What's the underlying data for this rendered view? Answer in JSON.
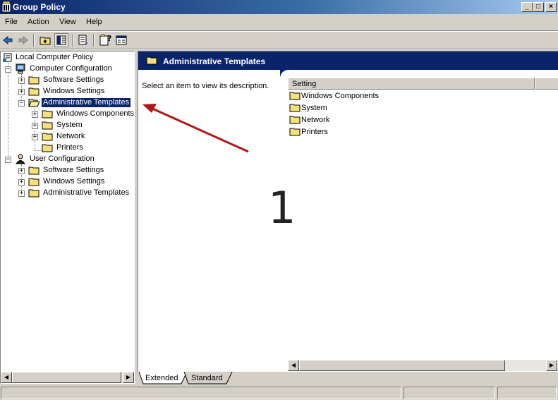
{
  "window": {
    "title": "Group Policy",
    "minimize_glyph": "_",
    "maximize_glyph": "□",
    "close_glyph": "×"
  },
  "menu": {
    "items": [
      "File",
      "Action",
      "View",
      "Help"
    ]
  },
  "toolbar": {
    "buttons": [
      "back-arrow-icon",
      "forward-arrow-icon",
      "up-folder-icon",
      "show-hide-tree-icon",
      "export-list-icon",
      "help-icon",
      "properties-icon"
    ]
  },
  "tree": {
    "root": "Local Computer Policy",
    "computer_config": "Computer Configuration",
    "cc_software": "Software Settings",
    "cc_windows": "Windows Settings",
    "cc_admin": "Administrative Templates",
    "cc_admin_windows_components": "Windows Components",
    "cc_admin_system": "System",
    "cc_admin_network": "Network",
    "cc_admin_printers": "Printers",
    "user_config": "User Configuration",
    "uc_software": "Software Settings",
    "uc_windows": "Windows Settings",
    "uc_admin": "Administrative Templates",
    "selected": "Administrative Templates"
  },
  "details": {
    "banner_title": "Administrative Templates",
    "description_prompt": "Select an item to view its description.",
    "column_header": "Setting",
    "items": [
      "Windows Components",
      "System",
      "Network",
      "Printers"
    ]
  },
  "annotation": {
    "number": "1",
    "arrow_color": "#b01818"
  },
  "tabs": {
    "extended": "Extended",
    "standard": "Standard",
    "active": "Extended"
  },
  "colors": {
    "selection": "#0a246a",
    "banner": "#0a246a",
    "folder": "#f5e07a"
  }
}
